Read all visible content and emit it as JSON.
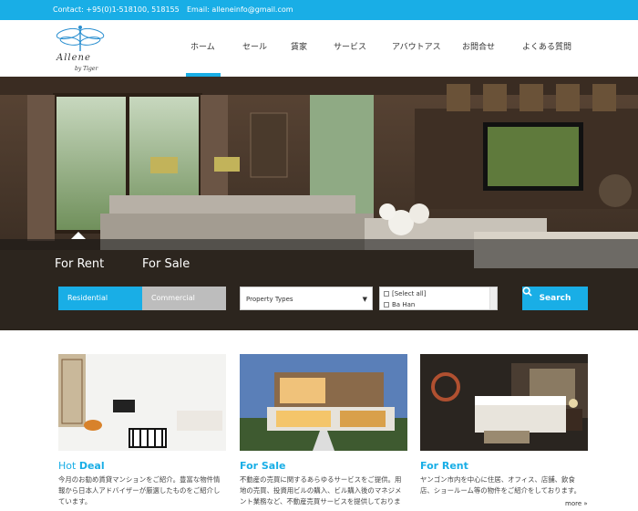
{
  "topbar": {
    "contact": "Contact: +95(0)1-518100, 518155",
    "email": "Email: alleneinfo@gmail.com"
  },
  "logo": {
    "brand": "Allene",
    "tagline": "by Tiger",
    "icon": "dragonfly-logo-icon"
  },
  "nav": {
    "items": [
      {
        "label": "ホーム",
        "active": true
      },
      {
        "label": "セール",
        "active": false
      },
      {
        "label": "賃家",
        "active": false
      },
      {
        "label": "サービス",
        "active": false
      },
      {
        "label": "アバウトアス",
        "active": false
      },
      {
        "label": "お問合せ",
        "active": false
      },
      {
        "label": "よくある質問",
        "active": false
      }
    ]
  },
  "search": {
    "tabs": [
      "For Rent",
      "For Sale"
    ],
    "active_tab": "For Rent",
    "segments": {
      "residential": "Residential",
      "commercial": "Commercial"
    },
    "active_segment": "Residential",
    "property_type": "Property Types",
    "locations": [
      "[Select all]",
      "Ba Han"
    ],
    "button_label": "Search"
  },
  "cards": [
    {
      "title_prefix": "Hot ",
      "title_emph": "Deal",
      "desc": "今月のお勧め賃貸マンションをご紹介。豊富な物件情報から日本人アドバイザーが厳選したものをご紹介しています。"
    },
    {
      "title_prefix": "",
      "title_emph": "For Sale",
      "desc": "不動産の売買に関するあらゆるサービスをご提供。用地の売買、投資用ビルの購入、ビル購入後のマネジメント業務など、不動産売買サービスを提供しておりま"
    },
    {
      "title_prefix": "",
      "title_emph": "For Rent",
      "desc": "ヤンゴン市内を中心に住居、オフィス、店舗、飲食店、ショールーム等の物件をご紹介をしております。"
    }
  ],
  "more_link": "more »",
  "colors": {
    "accent": "#19aee6",
    "segment_inactive": "#bdbdbd"
  }
}
